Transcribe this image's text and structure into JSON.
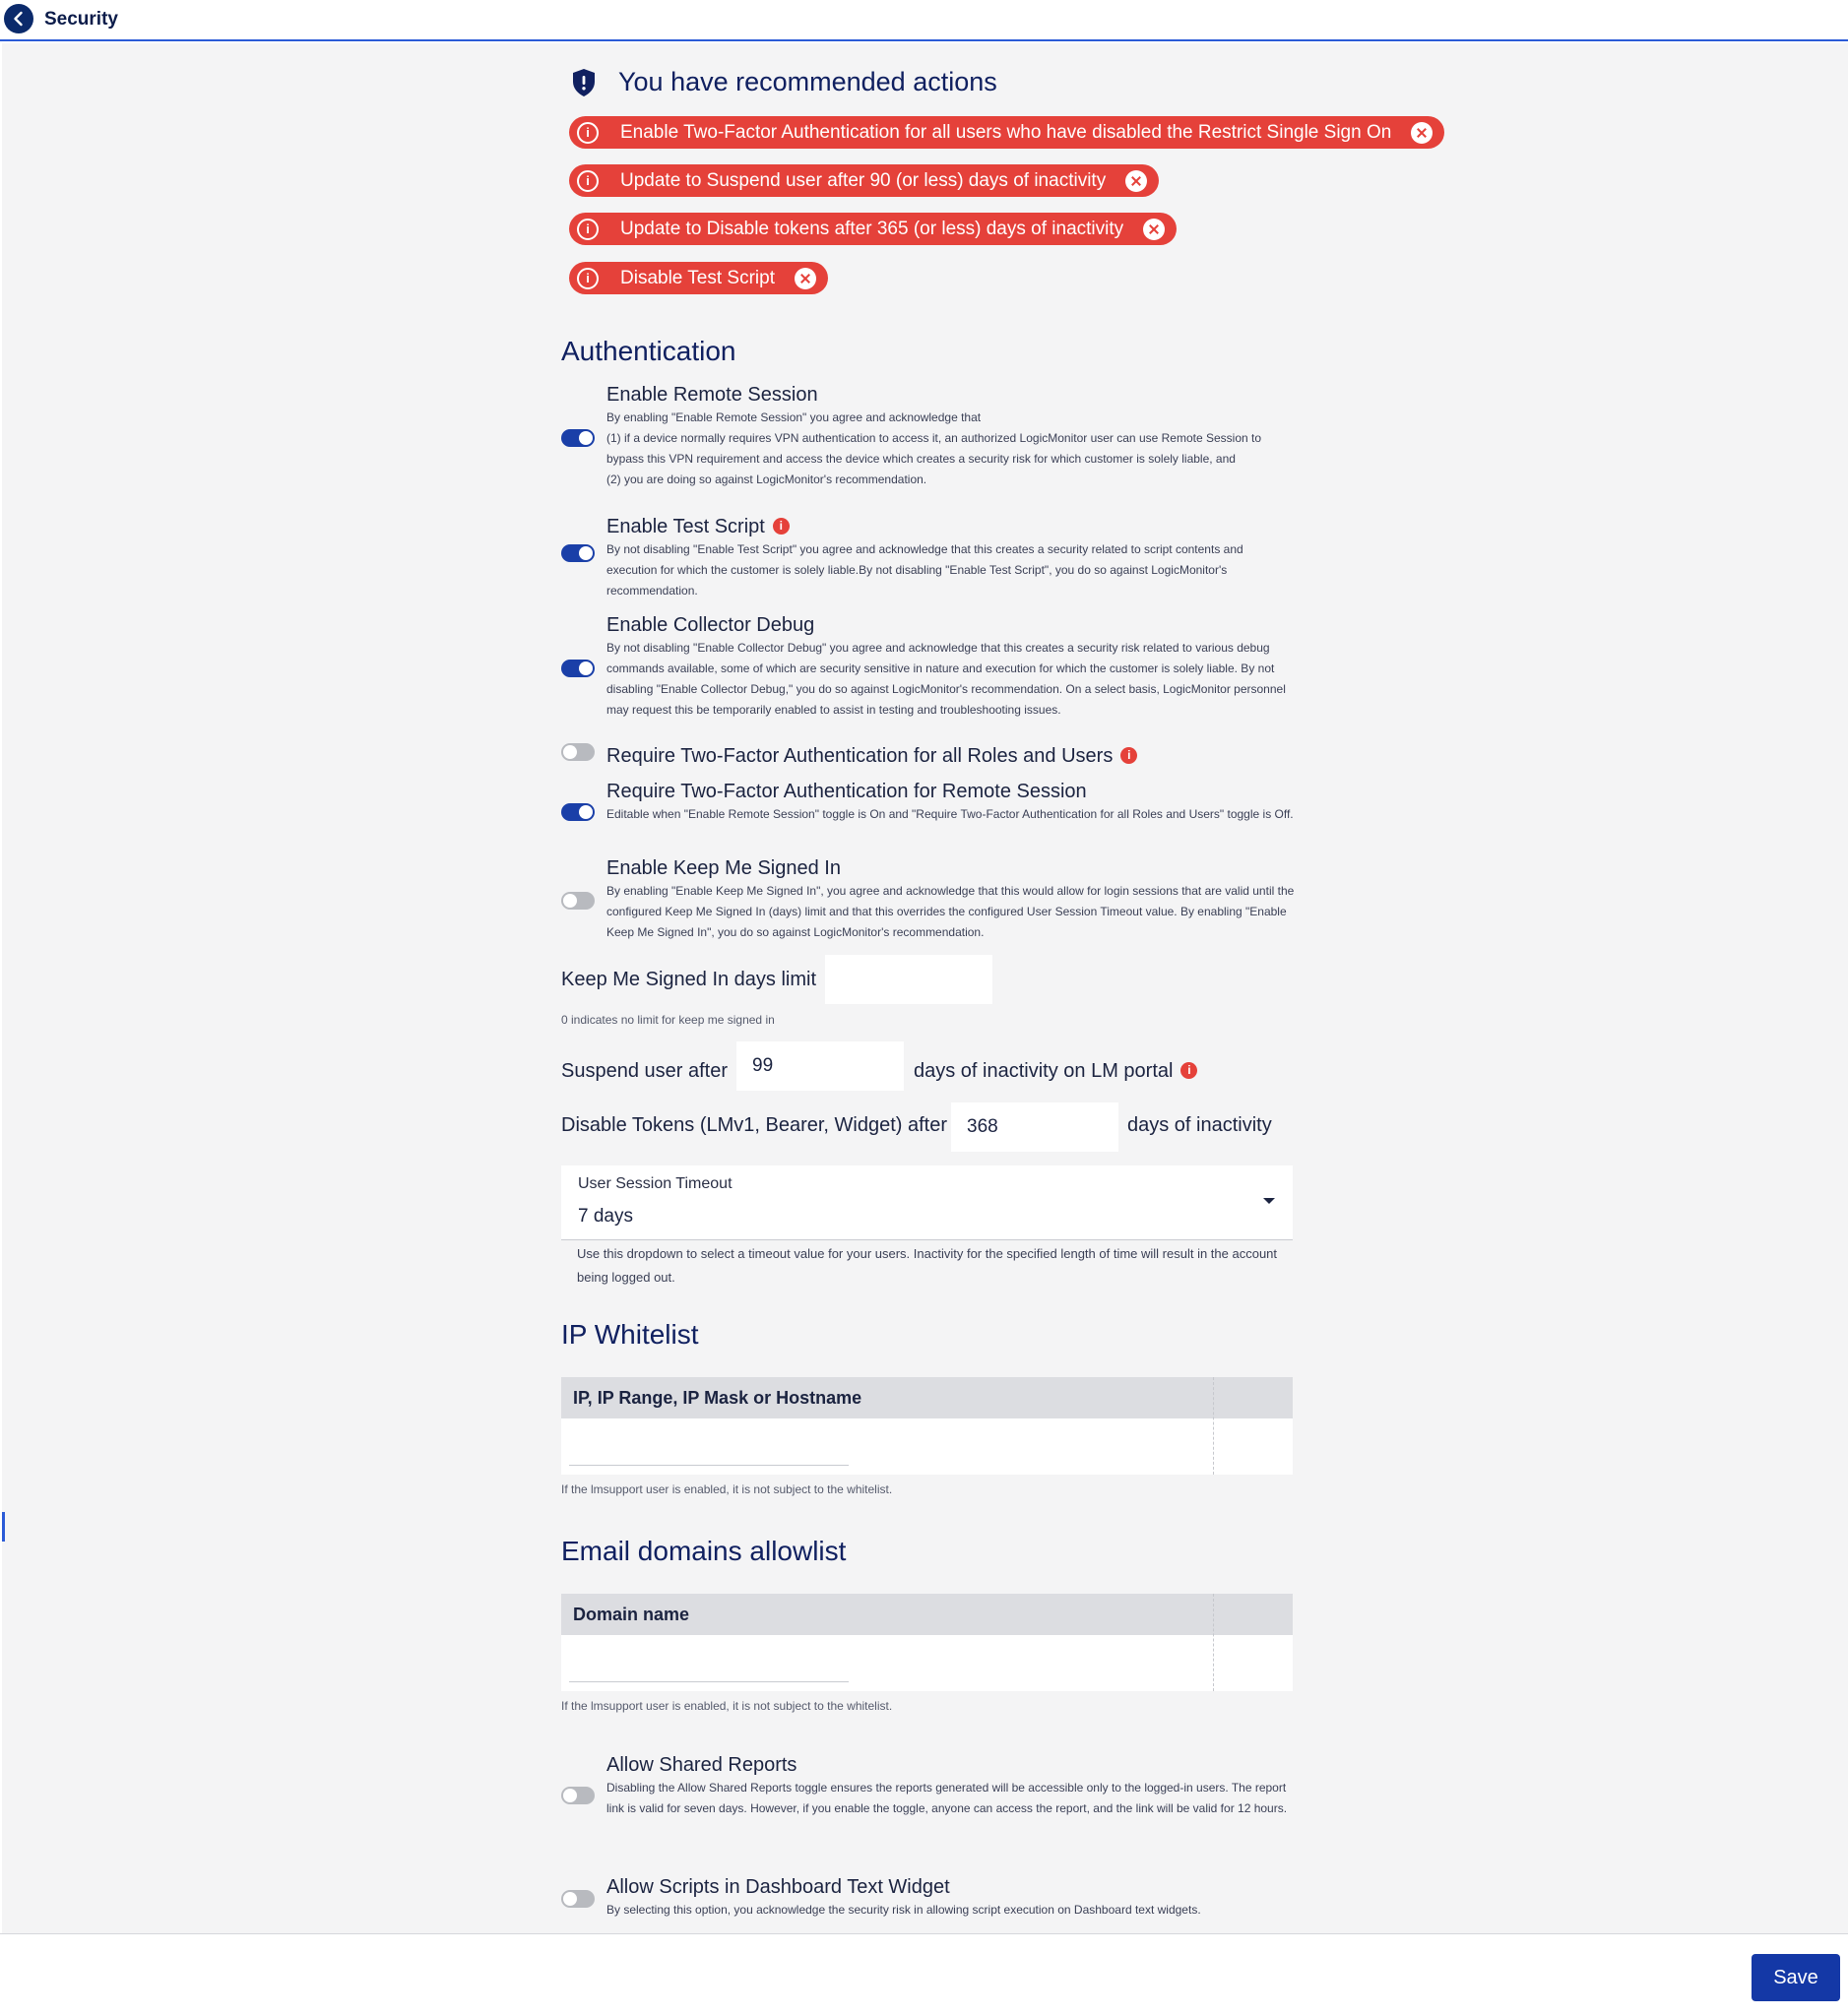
{
  "header": {
    "title": "Security",
    "back_icon": "chevron-left-icon"
  },
  "recommendations": {
    "title": "You have recommended actions",
    "items": [
      {
        "label": "Enable Two-Factor Authentication for all users who have disabled the Restrict Single Sign On"
      },
      {
        "label": "Update to Suspend user after 90 (or less) days of inactivity"
      },
      {
        "label": "Update to Disable tokens after 365 (or less) days of inactivity"
      },
      {
        "label": "Disable Test Script"
      }
    ]
  },
  "authentication": {
    "title": "Authentication",
    "remote_session": {
      "name": "Enable Remote Session",
      "enabled": true,
      "desc": "By enabling \"Enable Remote Session\" you agree and acknowledge that\n(1) if a device normally requires VPN authentication to access it, an authorized LogicMonitor user can use Remote Session to bypass this VPN requirement and access the device which creates a security risk for which customer is solely liable, and\n(2) you are doing so against LogicMonitor's recommendation."
    },
    "test_script": {
      "name": "Enable Test Script",
      "enabled": true,
      "desc": "By not disabling \"Enable Test Script\" you agree and acknowledge that this creates a security related to script contents and execution for which the customer is solely liable.By not disabling \"Enable Test Script\", you do so against LogicMonitor's recommendation."
    },
    "collector_debug": {
      "name": "Enable Collector Debug",
      "enabled": true,
      "desc": "By not disabling \"Enable Collector Debug\" you agree and acknowledge that this creates a security risk related to various debug commands available, some of which are security sensitive in nature and execution for which the customer is solely liable. By not disabling \"Enable Collector Debug,\" you do so against LogicMonitor's recommendation. On a select basis, LogicMonitor personnel may request this be temporarily enabled to assist in testing and troubleshooting issues."
    },
    "two_factor_all": {
      "name": "Require Two-Factor Authentication for all Roles and Users",
      "enabled": false
    },
    "two_factor_remote": {
      "name": "Require Two-Factor Authentication for Remote Session",
      "enabled": true,
      "desc": "Editable when \"Enable Remote Session\" toggle is On and \"Require Two-Factor Authentication for all Roles and Users\" toggle is Off."
    },
    "keep_signed_in": {
      "name": "Enable Keep Me Signed In",
      "enabled": false,
      "desc": "By enabling \"Enable Keep Me Signed In\", you agree and acknowledge that this would allow for login sessions that are valid until the configured Keep Me Signed In (days) limit and that this overrides the configured User Session Timeout value. By enabling \"Enable Keep Me Signed In\", you do so against LogicMonitor's recommendation."
    },
    "keep_signed_in_limit": {
      "label": "Keep Me Signed In days limit",
      "value": "",
      "note": "0 indicates no limit for keep me signed in"
    },
    "suspend_user": {
      "prefix": "Suspend user after",
      "value": "99",
      "suffix": "days of inactivity on LM portal"
    },
    "disable_tokens": {
      "prefix": "Disable Tokens (LMv1, Bearer, Widget) after",
      "value": "368",
      "suffix": "days of inactivity"
    },
    "session_timeout": {
      "label": "User Session Timeout",
      "value": "7 days",
      "help": "Use this dropdown to select a timeout value for your users. Inactivity for the specified length of time will result in the account being logged out."
    }
  },
  "ip_whitelist": {
    "title": "IP Whitelist",
    "column": "IP, IP Range, IP Mask or Hostname",
    "note": "If the lmsupport user is enabled, it is not subject to the whitelist."
  },
  "email_allowlist": {
    "title": "Email domains allowlist",
    "column": "Domain name",
    "note": "If the lmsupport user is enabled, it is not subject to the whitelist."
  },
  "reports": {
    "shared_reports": {
      "name": "Allow Shared Reports",
      "enabled": false,
      "desc": "Disabling the Allow Shared Reports toggle ensures the reports generated will be accessible only to the logged-in users. The report link is valid for seven days. However, if you enable the toggle, anyone can access the report, and the link will be valid for 12 hours."
    },
    "dashboard_scripts": {
      "name": "Allow Scripts in Dashboard Text Widget",
      "enabled": false,
      "desc": "By selecting this option, you acknowledge the security risk in allowing script execution on Dashboard text widgets."
    }
  },
  "footer": {
    "save_label": "Save"
  },
  "colors": {
    "accent": "#1438a6",
    "alert": "#e5413a",
    "heading": "#102060"
  }
}
